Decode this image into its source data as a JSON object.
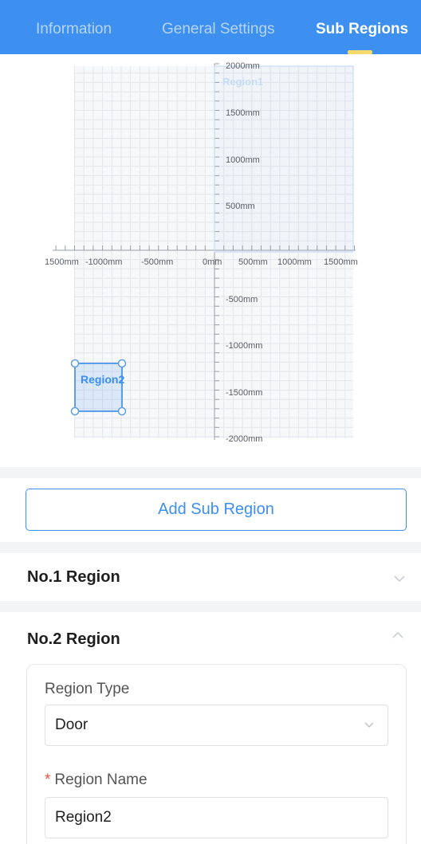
{
  "tabs": {
    "information": "Information",
    "general_settings": "General Settings",
    "sub_regions": "Sub Regions",
    "active": "Sub Regions"
  },
  "region_canvas": {
    "x_tick_labels": [
      "1500mm",
      "-1000mm",
      "-500mm",
      "0mm",
      "500mm",
      "1000mm",
      "1500mm"
    ],
    "y_tick_labels": [
      "2000mm",
      "1500mm",
      "1000mm",
      "500mm",
      "-500mm",
      "-1000mm",
      "-1500mm",
      "-2000mm"
    ],
    "region1_label": "Region1",
    "region2_label": "Region2"
  },
  "add_sub_region_label": "Add Sub Region",
  "regions": [
    {
      "title": "No.1 Region",
      "expanded": false
    },
    {
      "title": "No.2 Region",
      "expanded": true
    }
  ],
  "region2_form": {
    "region_type_label": "Region Type",
    "region_type_value": "Door",
    "region_name_label": "Region Name",
    "region_name_value": "Region2",
    "required_mark": "*"
  },
  "colors": {
    "primary": "#3d8ff0",
    "tab_indicator": "#f6d86b",
    "required": "#f0533a"
  }
}
